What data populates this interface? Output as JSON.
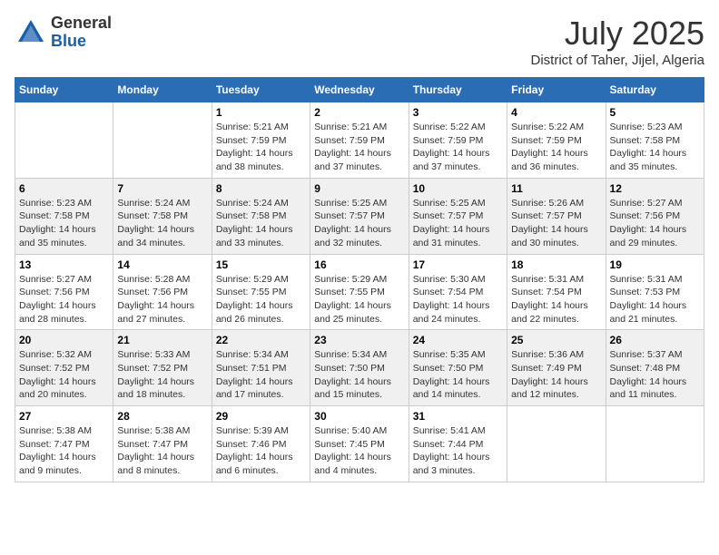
{
  "header": {
    "logo_general": "General",
    "logo_blue": "Blue",
    "month_title": "July 2025",
    "subtitle": "District of Taher, Jijel, Algeria"
  },
  "weekdays": [
    "Sunday",
    "Monday",
    "Tuesday",
    "Wednesday",
    "Thursday",
    "Friday",
    "Saturday"
  ],
  "weeks": [
    [
      {
        "day": "",
        "content": ""
      },
      {
        "day": "",
        "content": ""
      },
      {
        "day": "1",
        "content": "Sunrise: 5:21 AM\nSunset: 7:59 PM\nDaylight: 14 hours\nand 38 minutes."
      },
      {
        "day": "2",
        "content": "Sunrise: 5:21 AM\nSunset: 7:59 PM\nDaylight: 14 hours\nand 37 minutes."
      },
      {
        "day": "3",
        "content": "Sunrise: 5:22 AM\nSunset: 7:59 PM\nDaylight: 14 hours\nand 37 minutes."
      },
      {
        "day": "4",
        "content": "Sunrise: 5:22 AM\nSunset: 7:59 PM\nDaylight: 14 hours\nand 36 minutes."
      },
      {
        "day": "5",
        "content": "Sunrise: 5:23 AM\nSunset: 7:58 PM\nDaylight: 14 hours\nand 35 minutes."
      }
    ],
    [
      {
        "day": "6",
        "content": "Sunrise: 5:23 AM\nSunset: 7:58 PM\nDaylight: 14 hours\nand 35 minutes."
      },
      {
        "day": "7",
        "content": "Sunrise: 5:24 AM\nSunset: 7:58 PM\nDaylight: 14 hours\nand 34 minutes."
      },
      {
        "day": "8",
        "content": "Sunrise: 5:24 AM\nSunset: 7:58 PM\nDaylight: 14 hours\nand 33 minutes."
      },
      {
        "day": "9",
        "content": "Sunrise: 5:25 AM\nSunset: 7:57 PM\nDaylight: 14 hours\nand 32 minutes."
      },
      {
        "day": "10",
        "content": "Sunrise: 5:25 AM\nSunset: 7:57 PM\nDaylight: 14 hours\nand 31 minutes."
      },
      {
        "day": "11",
        "content": "Sunrise: 5:26 AM\nSunset: 7:57 PM\nDaylight: 14 hours\nand 30 minutes."
      },
      {
        "day": "12",
        "content": "Sunrise: 5:27 AM\nSunset: 7:56 PM\nDaylight: 14 hours\nand 29 minutes."
      }
    ],
    [
      {
        "day": "13",
        "content": "Sunrise: 5:27 AM\nSunset: 7:56 PM\nDaylight: 14 hours\nand 28 minutes."
      },
      {
        "day": "14",
        "content": "Sunrise: 5:28 AM\nSunset: 7:56 PM\nDaylight: 14 hours\nand 27 minutes."
      },
      {
        "day": "15",
        "content": "Sunrise: 5:29 AM\nSunset: 7:55 PM\nDaylight: 14 hours\nand 26 minutes."
      },
      {
        "day": "16",
        "content": "Sunrise: 5:29 AM\nSunset: 7:55 PM\nDaylight: 14 hours\nand 25 minutes."
      },
      {
        "day": "17",
        "content": "Sunrise: 5:30 AM\nSunset: 7:54 PM\nDaylight: 14 hours\nand 24 minutes."
      },
      {
        "day": "18",
        "content": "Sunrise: 5:31 AM\nSunset: 7:54 PM\nDaylight: 14 hours\nand 22 minutes."
      },
      {
        "day": "19",
        "content": "Sunrise: 5:31 AM\nSunset: 7:53 PM\nDaylight: 14 hours\nand 21 minutes."
      }
    ],
    [
      {
        "day": "20",
        "content": "Sunrise: 5:32 AM\nSunset: 7:52 PM\nDaylight: 14 hours\nand 20 minutes."
      },
      {
        "day": "21",
        "content": "Sunrise: 5:33 AM\nSunset: 7:52 PM\nDaylight: 14 hours\nand 18 minutes."
      },
      {
        "day": "22",
        "content": "Sunrise: 5:34 AM\nSunset: 7:51 PM\nDaylight: 14 hours\nand 17 minutes."
      },
      {
        "day": "23",
        "content": "Sunrise: 5:34 AM\nSunset: 7:50 PM\nDaylight: 14 hours\nand 15 minutes."
      },
      {
        "day": "24",
        "content": "Sunrise: 5:35 AM\nSunset: 7:50 PM\nDaylight: 14 hours\nand 14 minutes."
      },
      {
        "day": "25",
        "content": "Sunrise: 5:36 AM\nSunset: 7:49 PM\nDaylight: 14 hours\nand 12 minutes."
      },
      {
        "day": "26",
        "content": "Sunrise: 5:37 AM\nSunset: 7:48 PM\nDaylight: 14 hours\nand 11 minutes."
      }
    ],
    [
      {
        "day": "27",
        "content": "Sunrise: 5:38 AM\nSunset: 7:47 PM\nDaylight: 14 hours\nand 9 minutes."
      },
      {
        "day": "28",
        "content": "Sunrise: 5:38 AM\nSunset: 7:47 PM\nDaylight: 14 hours\nand 8 minutes."
      },
      {
        "day": "29",
        "content": "Sunrise: 5:39 AM\nSunset: 7:46 PM\nDaylight: 14 hours\nand 6 minutes."
      },
      {
        "day": "30",
        "content": "Sunrise: 5:40 AM\nSunset: 7:45 PM\nDaylight: 14 hours\nand 4 minutes."
      },
      {
        "day": "31",
        "content": "Sunrise: 5:41 AM\nSunset: 7:44 PM\nDaylight: 14 hours\nand 3 minutes."
      },
      {
        "day": "",
        "content": ""
      },
      {
        "day": "",
        "content": ""
      }
    ]
  ]
}
